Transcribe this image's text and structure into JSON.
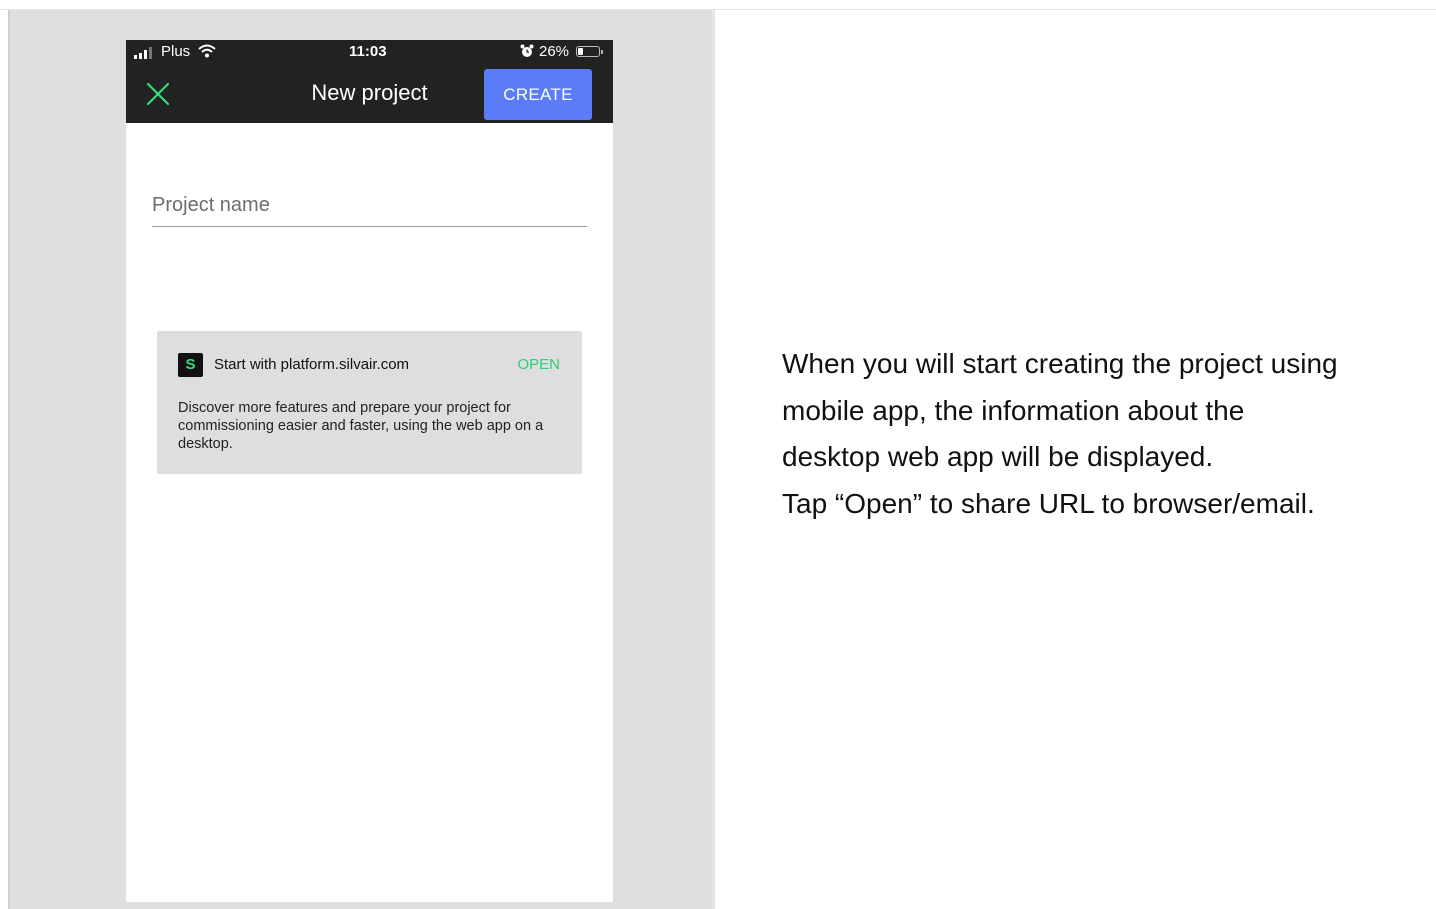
{
  "status_bar": {
    "carrier": "Plus",
    "time": "11:03",
    "battery_percent": "26%",
    "battery_level": 0.26,
    "signal_icon": "signal-bars-icon",
    "wifi_icon": "wifi-icon",
    "alarm_icon": "alarm-clock-icon"
  },
  "app_bar": {
    "close_icon": "close-icon",
    "title": "New project",
    "create_label": "CREATE"
  },
  "form": {
    "project_name_placeholder": "Project name",
    "project_name_value": ""
  },
  "card": {
    "logo_letter": "S",
    "title": "Start with platform.silvair.com",
    "open_label": "OPEN",
    "description": "Discover more features and prepare your project for commissioning easier and faster, using the web app on a desktop."
  },
  "instructions": {
    "lines": [
      "When you will start creating the project using",
      "mobile app, the information about the",
      "desktop web app will be displayed.",
      "Tap “Open”  to share URL to browser/email."
    ]
  },
  "colors": {
    "accent": "#5b7cf7",
    "brand_green": "#2ecf73",
    "app_bar": "#222222",
    "panel": "#dfdfe1"
  }
}
